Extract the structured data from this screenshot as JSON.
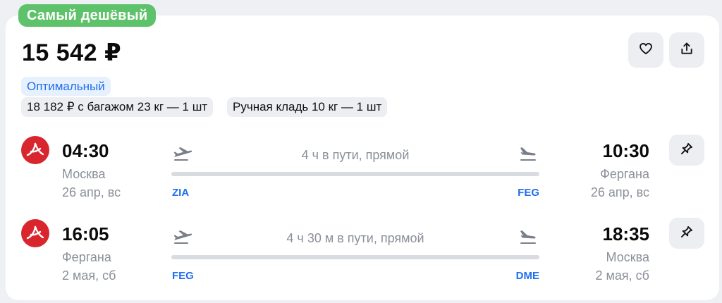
{
  "badge": "Самый дешёвый",
  "price": "15 542 ₽",
  "actions": {
    "favorite_icon": "heart-icon",
    "share_icon": "share-icon"
  },
  "tags": {
    "fare_type": "Оптимальный",
    "with_baggage": "18 182 ₽ с багажом 23 кг — 1 шт",
    "hand_luggage": "Ручная кладь 10 кг — 1 шт"
  },
  "colors": {
    "badge": "#5ec26a",
    "accent": "#1e6ff0",
    "airline": "#d9262e"
  },
  "segments": [
    {
      "dep_time": "04:30",
      "dep_city": "Москва",
      "dep_date": "26 апр, вс",
      "duration": "4 ч в пути, прямой",
      "from_code": "ZIA",
      "to_code": "FEG",
      "arr_time": "10:30",
      "arr_city": "Фергана",
      "arr_date": "26 апр, вс"
    },
    {
      "dep_time": "16:05",
      "dep_city": "Фергана",
      "dep_date": "2 мая, сб",
      "duration": "4 ч 30 м в пути, прямой",
      "from_code": "FEG",
      "to_code": "DME",
      "arr_time": "18:35",
      "arr_city": "Москва",
      "arr_date": "2 мая, сб"
    }
  ]
}
